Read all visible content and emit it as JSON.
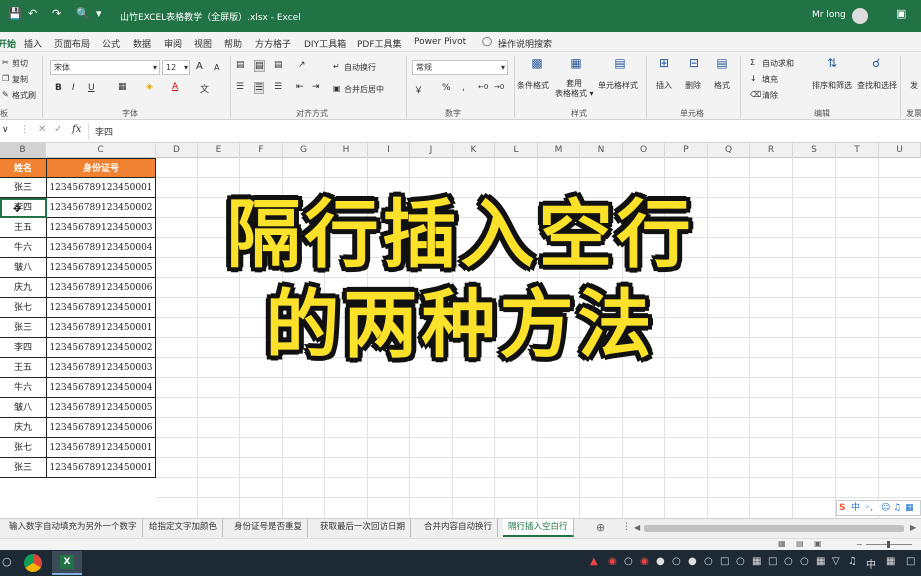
{
  "window": {
    "title": "山竹EXCEL表格教学（全屏版）.xlsx  -  Excel",
    "user": "Mr long"
  },
  "ribbon_tabs": [
    "开始",
    "插入",
    "页面布局",
    "公式",
    "数据",
    "审阅",
    "视图",
    "帮助",
    "方方格子",
    "DIY工具箱",
    "PDF工具集",
    "Power Pivot",
    "操作说明搜索"
  ],
  "ribbon": {
    "clipboard": {
      "cut": "剪切",
      "copy": "复制",
      "painter": "格式刷",
      "label": "板"
    },
    "font": {
      "name": "宋体",
      "size": "12",
      "label": "字体",
      "bold": "B",
      "italic": "I",
      "underline": "U",
      "grow": "A",
      "shrink": "A",
      "color_a": "A"
    },
    "align": {
      "wrap": "自动换行",
      "merge": "合并后居中",
      "label": "对齐方式"
    },
    "number": {
      "format": "常规",
      "label": "数字",
      "percent": "%"
    },
    "styles": {
      "cond": "条件格式",
      "table": "套用\n表格格式",
      "cell": "单元格样式",
      "label": "样式"
    },
    "cells": {
      "insert": "插入",
      "delete": "删除",
      "format": "格式",
      "label": "单元格"
    },
    "editing": {
      "autosum": "自动求和",
      "fill": "填充",
      "clear": "清除",
      "sort": "排序和筛选",
      "find": "查找和选择",
      "label": "编辑"
    },
    "extra": {
      "send": "发",
      "send2": "发票"
    }
  },
  "formula_bar": {
    "fx": "fx",
    "value": "李四"
  },
  "columns": [
    "B",
    "C",
    "D",
    "E",
    "F",
    "G",
    "H",
    "I",
    "J",
    "K",
    "L",
    "M",
    "N",
    "O",
    "P",
    "Q",
    "R",
    "S",
    "T",
    "U"
  ],
  "table": {
    "headers": [
      "姓名",
      "身份证号"
    ],
    "rows": [
      [
        "张三",
        "123456789123450001"
      ],
      [
        "李四",
        "123456789123450002"
      ],
      [
        "王五",
        "123456789123450003"
      ],
      [
        "牛六",
        "123456789123450004"
      ],
      [
        "皱八",
        "123456789123450005"
      ],
      [
        "庆九",
        "123456789123450006"
      ],
      [
        "张七",
        "123456789123450001"
      ],
      [
        "张三",
        "123456789123450001"
      ],
      [
        "李四",
        "123456789123450002"
      ],
      [
        "王五",
        "123456789123450003"
      ],
      [
        "牛六",
        "123456789123450004"
      ],
      [
        "皱八",
        "123456789123450005"
      ],
      [
        "庆九",
        "123456789123450006"
      ],
      [
        "张七",
        "123456789123450001"
      ],
      [
        "张三",
        "123456789123450001"
      ]
    ]
  },
  "overlay": {
    "line1": "隔行插入空行",
    "line2": "的两种方法"
  },
  "sheet_tabs": [
    "输入数字自动填充为另外一个数字",
    "给指定文字加颜色",
    "身份证号是否重复",
    "获取最后一次回访日期",
    "合并内容自动换行",
    "隔行插入空白行"
  ],
  "active_sheet": 5,
  "tray": {
    "ime": "中"
  },
  "colors": {
    "excel_green": "#217346",
    "header_orange": "#f08231",
    "overlay_yellow": "#fbe12a"
  }
}
